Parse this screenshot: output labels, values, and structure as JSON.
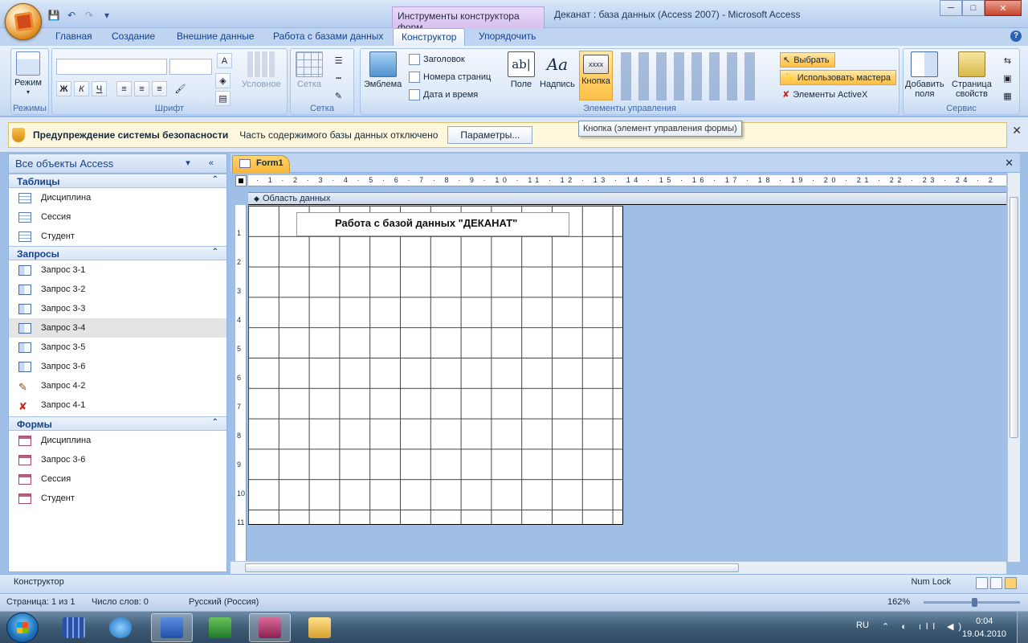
{
  "window": {
    "context_tab": "Инструменты конструктора форм",
    "title": "Деканат : база данных (Access 2007) - Microsoft Access",
    "minimize": "─",
    "maximize": "□",
    "close": "✕"
  },
  "qat": {
    "save_icon": "💾",
    "undo_icon": "↶",
    "redo_icon": "↷",
    "customize_icon": "▾"
  },
  "tabs": [
    "Главная",
    "Создание",
    "Внешние данные",
    "Работа с базами данных",
    "Конструктор",
    "Упорядочить"
  ],
  "help_icon": "?",
  "ribbon": {
    "groups": {
      "views": "Режимы",
      "font": "Шрифт",
      "grid": "Сетка",
      "controls": "Элементы управления",
      "tools": "Сервис"
    },
    "view_button": "Режим",
    "conditional": "Условное",
    "grid_button": "Сетка",
    "logo_button": "Эмблема",
    "title_button": "Заголовок",
    "page_numbers": "Номера страниц",
    "date_time": "Дата и время",
    "field_button": "Поле",
    "label_button": "Надпись",
    "button_button": "Кнопка",
    "select_button": "Выбрать",
    "wizards_button": "Использовать мастера",
    "activex_button": "Элементы ActiveX",
    "add_fields": [
      "Добавить",
      "поля"
    ],
    "property_sheet": [
      "Страница",
      "свойств"
    ],
    "bold": "Ж",
    "italic": "К",
    "underline": "Ч",
    "button_preview": "xxxx",
    "field_preview": "ab|",
    "label_preview": "Aa"
  },
  "security": {
    "title": "Предупреждение системы безопасности",
    "message": "Часть содержимого базы данных отключено",
    "options": "Параметры...",
    "close": "✕"
  },
  "tooltip": "Кнопка (элемент управления формы)",
  "nav": {
    "header": "Все объекты Access",
    "header_arrows": "▾ «",
    "sections": [
      {
        "title": "Таблицы",
        "items": [
          "Дисциплина",
          "Сессия",
          "Студент"
        ]
      },
      {
        "title": "Запросы",
        "items": [
          "Запрос 3-1",
          "Запрос 3-2",
          "Запрос 3-3",
          "Запрос 3-4",
          "Запрос 3-5",
          "Запрос 3-6",
          "Запрос 4-2",
          "Запрос 4-1"
        ]
      },
      {
        "title": "Формы",
        "items": [
          "Дисциплина",
          "Запрос 3-6",
          "Сессия",
          "Студент"
        ]
      }
    ],
    "chevron": "⌃"
  },
  "document": {
    "tab": "Form1",
    "close": "✕",
    "section": "Область данных",
    "section_icon": "◆",
    "label": "Работа с базой данных \"ДЕКАНАТ\"",
    "hruler": "· 1 · 2 · 3 · 4 · 5 · 6 · 7 · 8 · 9 · 10 · 11 · 12 · 13 · 14 · 15 · 16 · 17 · 18 · 19 · 20 · 21 · 22 · 23 · 24 · 2",
    "vruler": [
      "1",
      "2",
      "3",
      "4",
      "5",
      "6",
      "7",
      "8",
      "9",
      "10",
      "11"
    ]
  },
  "status": {
    "mode": "Конструктор",
    "numlock": "Num Lock"
  },
  "word_status": {
    "page": "Страница: 1 из 1",
    "words": "Число слов: 0",
    "language": "Русский (Россия)",
    "zoom": "162%"
  },
  "taskbar": {
    "lang": "RU",
    "tray": "⌃ ◐ ıll ◀)",
    "time": "0:04",
    "date": "19.04.2010"
  }
}
